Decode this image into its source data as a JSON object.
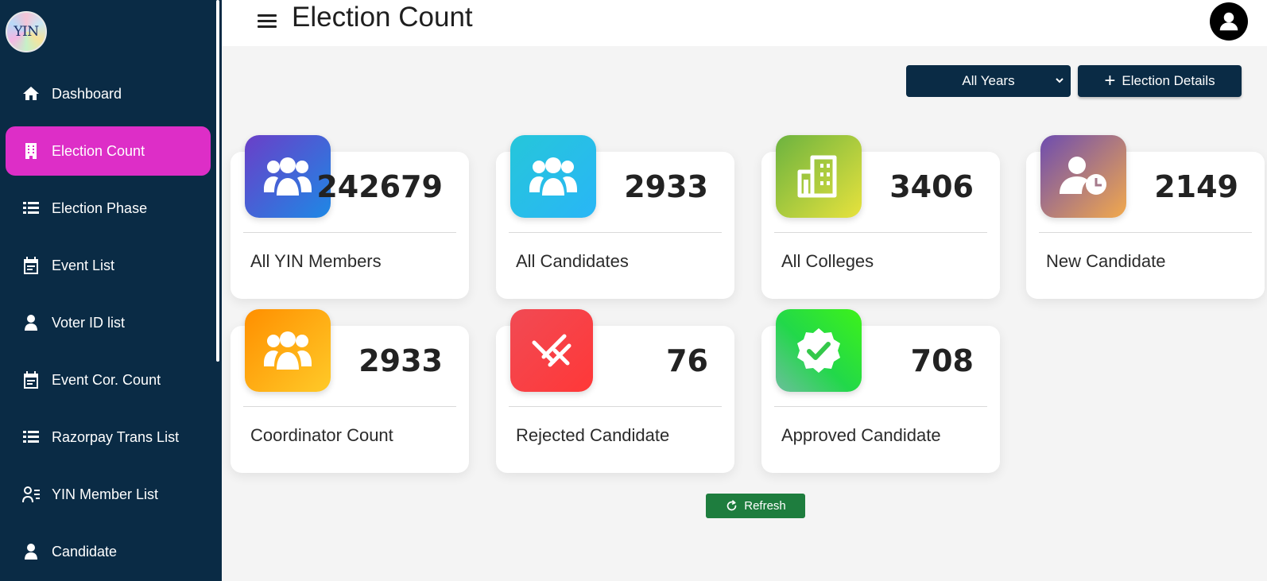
{
  "sidebar": {
    "logo_text": "YIN",
    "items": [
      {
        "label": "Dashboard",
        "icon": "home-icon"
      },
      {
        "label": "Election Count",
        "icon": "building-icon",
        "active": true
      },
      {
        "label": "Election Phase",
        "icon": "list-icon"
      },
      {
        "label": "Event List",
        "icon": "calendar-icon"
      },
      {
        "label": "Voter ID list",
        "icon": "user-icon"
      },
      {
        "label": "Event Cor. Count",
        "icon": "calendar-icon"
      },
      {
        "label": "Razorpay Trans List",
        "icon": "list-icon"
      },
      {
        "label": "YIN Member List",
        "icon": "user-list-icon"
      },
      {
        "label": "Candidate",
        "icon": "user-icon"
      }
    ]
  },
  "header": {
    "title": "Election Count",
    "menu_icon": "hamburger-icon",
    "profile_icon": "user-circle-icon"
  },
  "toolbar": {
    "year_select": "All Years",
    "election_details_label": "Election Details"
  },
  "cards": [
    {
      "value": "242679",
      "label": "All YIN Members",
      "icon": "users-group-icon",
      "colors": [
        "#6a3fc8",
        "#1e88e5"
      ]
    },
    {
      "value": "2933",
      "label": "All Candidates",
      "icon": "users-group-icon",
      "colors": [
        "#26c6da",
        "#29b6f6"
      ]
    },
    {
      "value": "3406",
      "label": "All Colleges",
      "icon": "building-icon",
      "colors": [
        "#8bc34a",
        "#e5e542"
      ]
    },
    {
      "value": "2149",
      "label": "New Candidate",
      "icon": "user-clock-icon",
      "colors": [
        "#6d4cb0",
        "#f2a94c"
      ]
    },
    {
      "value": "2933",
      "label": "Coordinator Count",
      "icon": "users-group-icon",
      "colors": [
        "#ff9800",
        "#ffc21a"
      ]
    },
    {
      "value": "76",
      "label": "Rejected Candidate",
      "icon": "rejected-slash-icon",
      "colors": [
        "#f14a54",
        "#ff3b3b"
      ]
    },
    {
      "value": "708",
      "label": "Approved Candidate",
      "icon": "verified-badge-icon",
      "colors": [
        "#3ee043",
        "#2ed62e"
      ]
    }
  ],
  "refresh_label": "Refresh",
  "colors": {
    "sidebar_bg": "#0a2b45",
    "active_item": "#dd2ec7",
    "refresh_btn": "#1e7d3e"
  }
}
